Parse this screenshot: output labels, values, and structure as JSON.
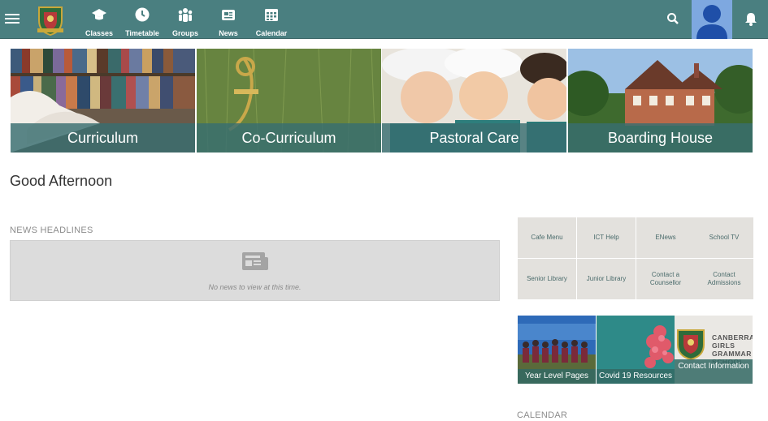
{
  "nav": {
    "items": [
      {
        "label": "Classes",
        "icon": "graduation-cap-icon"
      },
      {
        "label": "Timetable",
        "icon": "clock-icon"
      },
      {
        "label": "Groups",
        "icon": "people-icon"
      },
      {
        "label": "News",
        "icon": "newspaper-icon"
      },
      {
        "label": "Calendar",
        "icon": "calendar-icon"
      }
    ]
  },
  "hero": [
    {
      "label": "Curriculum"
    },
    {
      "label": "Co-Curriculum"
    },
    {
      "label": "Pastoral Care"
    },
    {
      "label": "Boarding House"
    }
  ],
  "greeting": "Good Afternoon",
  "news": {
    "title": "NEWS HEADLINES",
    "empty": "No news to view at this time."
  },
  "quick_links": [
    "Cafe Menu",
    "ICT Help",
    "ENews",
    "School TV",
    "Senior Library",
    "Junior Library",
    "Contact a Counsellor",
    "Contact Admissions"
  ],
  "promos": [
    {
      "label": "Year Level Pages"
    },
    {
      "label": "Covid 19 Resources"
    },
    {
      "label": "Contact Information",
      "logo_text": "CANBERRA GIRLS GRAMMAR SCHOOL"
    }
  ],
  "calendar": {
    "title": "CALENDAR"
  },
  "colors": {
    "brand": "#4a7f80",
    "caption": "#386e70",
    "tile": "#e3e1dd"
  }
}
